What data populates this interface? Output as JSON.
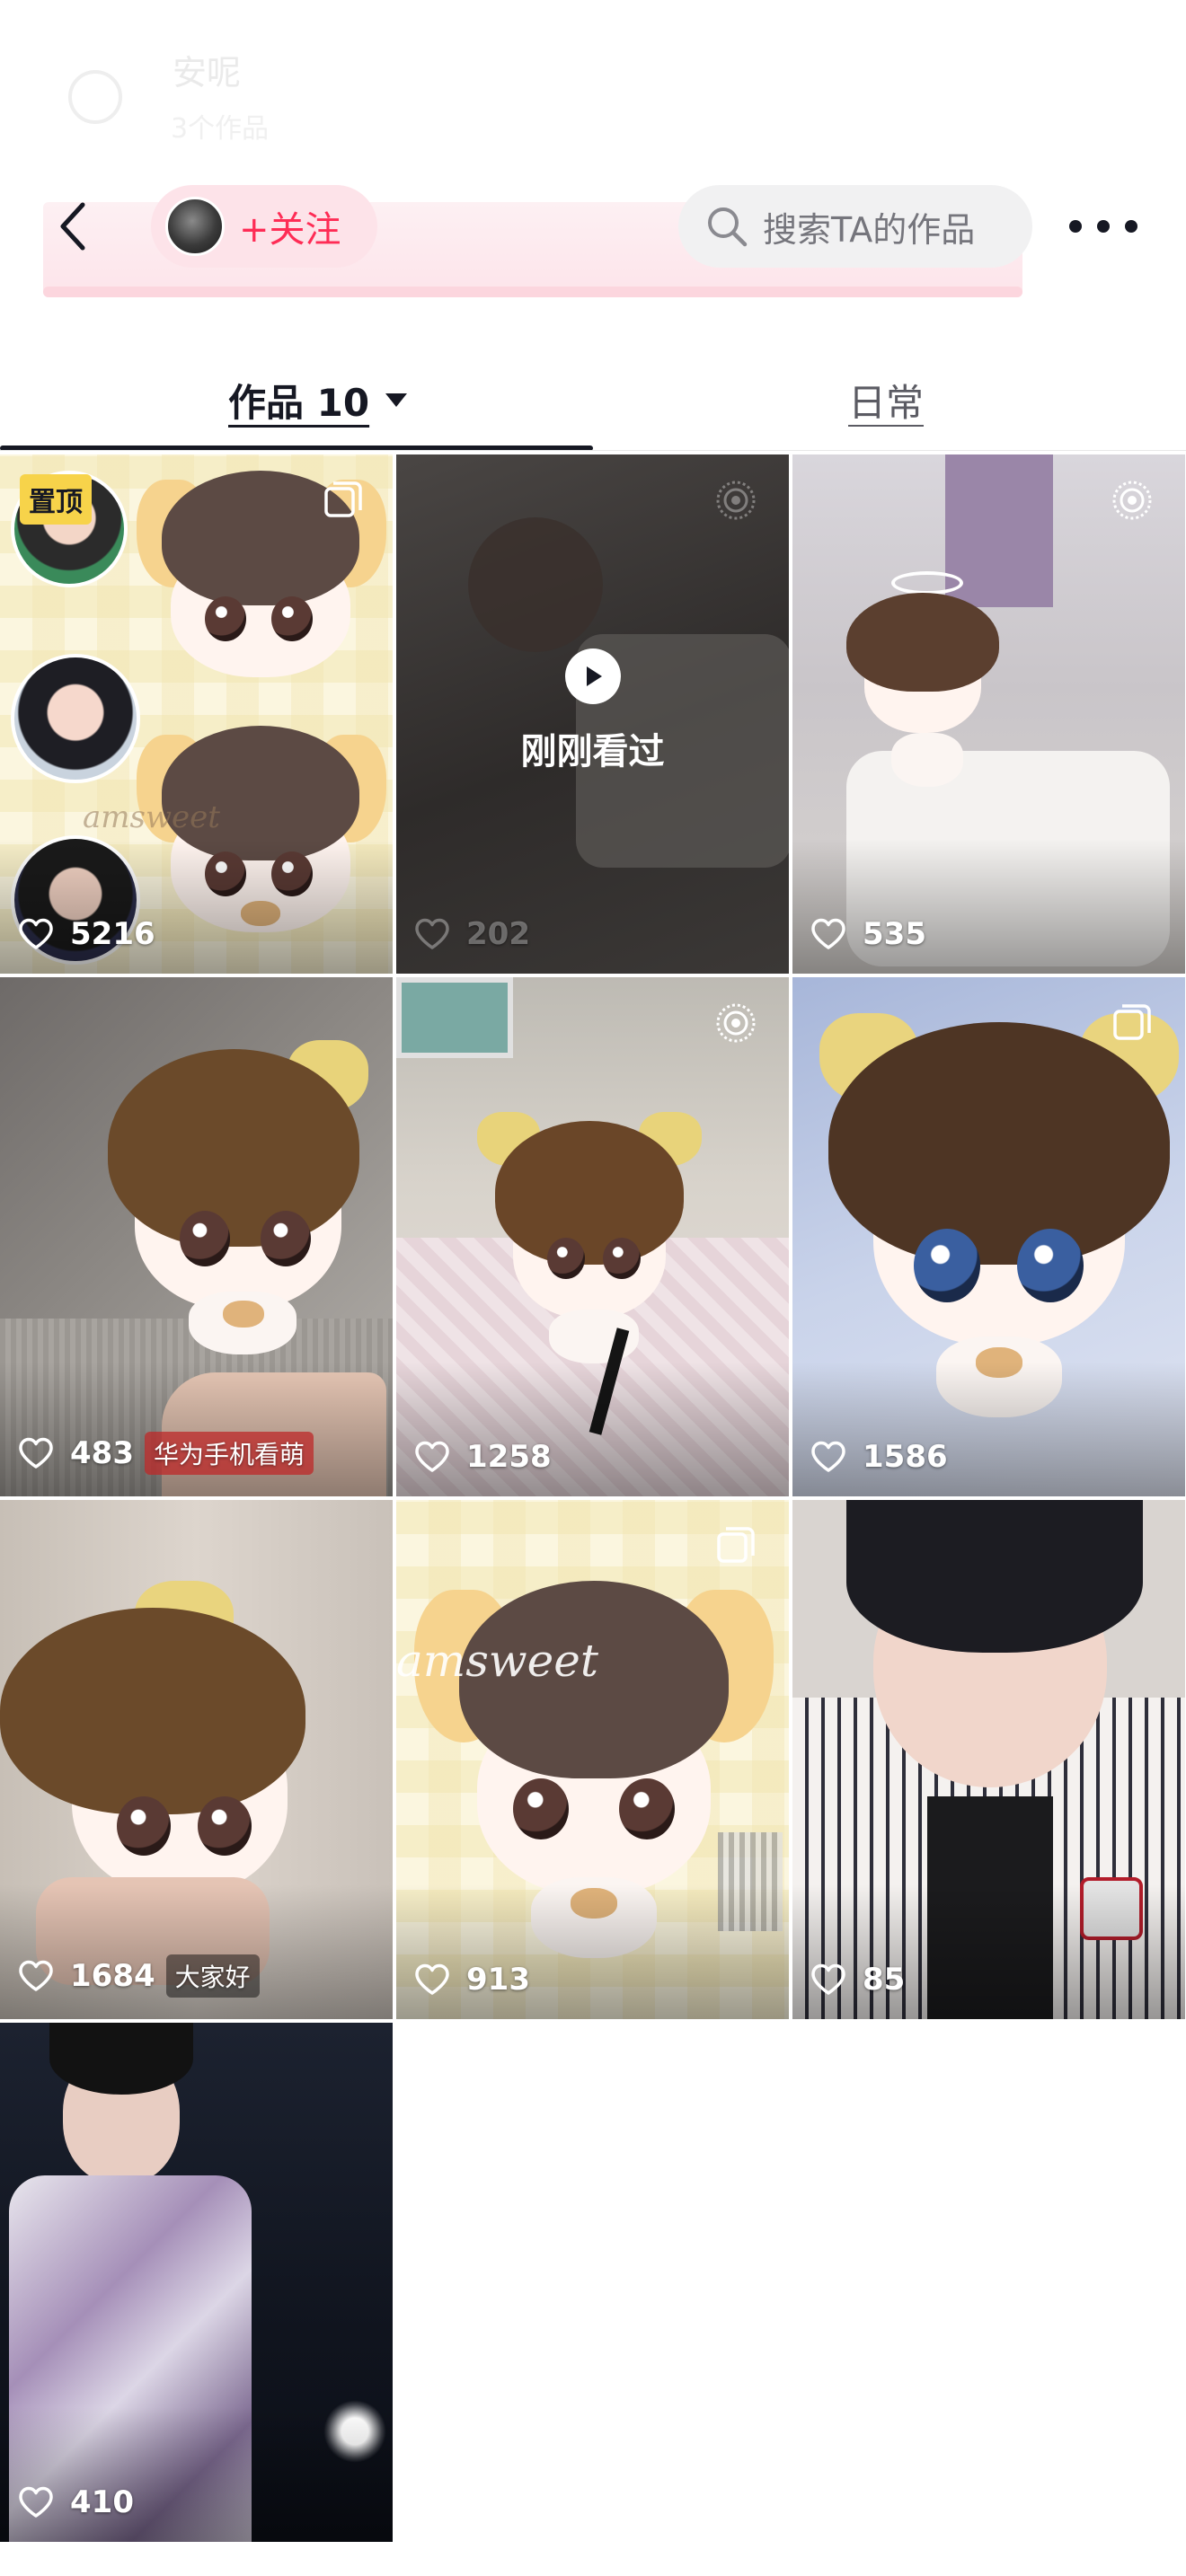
{
  "header": {
    "ghost_name": "安呢",
    "ghost_sub": "3个作品",
    "follow_label": "+关注",
    "search_placeholder": "搜索TA的作品"
  },
  "tabs": [
    {
      "label": "作品 10",
      "active": true
    },
    {
      "label": "日常",
      "active": false
    }
  ],
  "videos": [
    {
      "likes": "5216",
      "pinned": true,
      "pin_label": "置顶",
      "corner_icon": "multi-image-icon"
    },
    {
      "likes": "202",
      "watched": true,
      "watched_label": "刚刚看过",
      "corner_icon": "live-photo-icon"
    },
    {
      "likes": "535",
      "corner_icon": "live-photo-icon"
    },
    {
      "likes": "483",
      "overlay": "华为手机看萌"
    },
    {
      "likes": "1258",
      "corner_icon": "live-photo-icon"
    },
    {
      "likes": "1586",
      "corner_icon": "multi-image-icon"
    },
    {
      "likes": "1684",
      "overlay": "大家好"
    },
    {
      "likes": "913",
      "corner_icon": "multi-image-icon"
    },
    {
      "likes": "85"
    },
    {
      "likes": "410"
    }
  ],
  "colors": {
    "accent": "#fe2c55",
    "pin_badge": "#f7d34a"
  }
}
